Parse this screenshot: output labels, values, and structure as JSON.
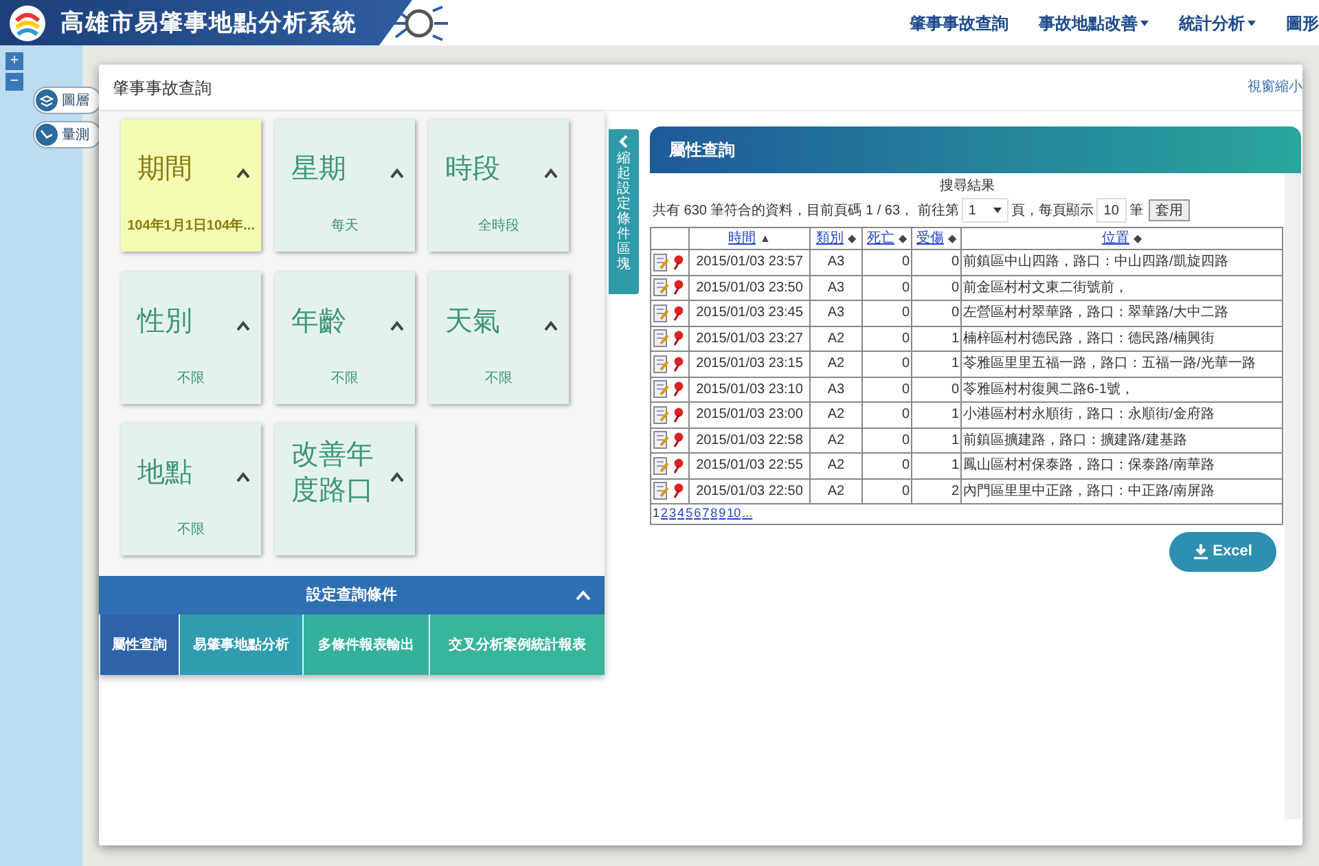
{
  "header": {
    "title": "高雄市易肇事地點分析系統",
    "nav": [
      {
        "label": "肇事事故查詢",
        "dropdown": false
      },
      {
        "label": "事故地點改善",
        "dropdown": true
      },
      {
        "label": "統計分析",
        "dropdown": true
      },
      {
        "label": "圖形",
        "dropdown": false
      }
    ]
  },
  "map_tools": {
    "zoom_in": "+",
    "zoom_out": "−",
    "buttons": [
      {
        "label": "圖層",
        "kind": "layers"
      },
      {
        "label": "量測",
        "kind": "measure"
      }
    ]
  },
  "dialog": {
    "title": "肇事事故查詢",
    "minimize": "視窗縮小",
    "filters": [
      {
        "title": "期間",
        "value": "104年1月1日104年...",
        "selected": true
      },
      {
        "title": "星期",
        "value": "每天",
        "selected": false
      },
      {
        "title": "時段",
        "value": "全時段",
        "selected": false
      },
      {
        "title": "性別",
        "value": "不限",
        "selected": false
      },
      {
        "title": "年齡",
        "value": "不限",
        "selected": false
      },
      {
        "title": "天氣",
        "value": "不限",
        "selected": false
      },
      {
        "title": "地點",
        "value": "不限",
        "selected": false
      },
      {
        "title": "改善年度路口",
        "selected": false
      }
    ],
    "settings_bar": "設定查詢條件",
    "tabs": [
      {
        "label": "屬性查詢",
        "selected": true
      },
      {
        "label": "易肇事地點分析",
        "selected": false
      },
      {
        "label": "多條件報表輸出",
        "selected": false
      },
      {
        "label": "交叉分析案例統計報表",
        "selected": false
      }
    ],
    "collapse_tab": "縮起設定條件區塊",
    "results": {
      "title": "屬性查詢",
      "caption": "搜尋結果",
      "summary_before": "共有 630 筆符合的資料，目前頁碼 1 / 63， 前往第",
      "page_select": "1",
      "summary_middle": "頁，每頁顯示",
      "page_size": "10",
      "summary_after": "筆",
      "apply": "套用",
      "columns": [
        {
          "label": "時間",
          "sort_icon": "▲"
        },
        {
          "label": "類別",
          "sort_icon": "◆"
        },
        {
          "label": "死亡",
          "sort_icon": "◆"
        },
        {
          "label": "受傷",
          "sort_icon": "◆"
        },
        {
          "label": "位置",
          "sort_icon": "◆"
        }
      ],
      "rows": [
        {
          "time": "2015/01/03 23:57",
          "type": "A3",
          "deaths": "0",
          "injuries": "0",
          "location": "前鎮區中山四路，路口：中山四路/凱旋四路"
        },
        {
          "time": "2015/01/03 23:50",
          "type": "A3",
          "deaths": "0",
          "injuries": "0",
          "location": "前金區村村文東二街號前，"
        },
        {
          "time": "2015/01/03 23:45",
          "type": "A3",
          "deaths": "0",
          "injuries": "0",
          "location": "左營區村村翠華路，路口：翠華路/大中二路"
        },
        {
          "time": "2015/01/03 23:27",
          "type": "A2",
          "deaths": "0",
          "injuries": "1",
          "location": "楠梓區村村德民路，路口：德民路/楠興街"
        },
        {
          "time": "2015/01/03 23:15",
          "type": "A2",
          "deaths": "0",
          "injuries": "1",
          "location": "苓雅區里里五福一路，路口：五福一路/光華一路"
        },
        {
          "time": "2015/01/03 23:10",
          "type": "A3",
          "deaths": "0",
          "injuries": "0",
          "location": "苓雅區村村復興二路6-1號，"
        },
        {
          "time": "2015/01/03 23:00",
          "type": "A2",
          "deaths": "0",
          "injuries": "1",
          "location": "小港區村村永順街，路口：永順街/金府路"
        },
        {
          "time": "2015/01/03 22:58",
          "type": "A2",
          "deaths": "0",
          "injuries": "1",
          "location": "前鎮區擴建路，路口：擴建路/建基路"
        },
        {
          "time": "2015/01/03 22:55",
          "type": "A2",
          "deaths": "0",
          "injuries": "1",
          "location": "鳳山區村村保泰路，路口：保泰路/南華路"
        },
        {
          "time": "2015/01/03 22:50",
          "type": "A2",
          "deaths": "0",
          "injuries": "2",
          "location": "內門區里里中正路，路口：中正路/南屏路"
        }
      ],
      "pages": [
        {
          "label": "1",
          "selected": true
        },
        {
          "label": "2",
          "selected": false
        },
        {
          "label": "3",
          "selected": false
        },
        {
          "label": "4",
          "selected": false
        },
        {
          "label": "5",
          "selected": false
        },
        {
          "label": "6",
          "selected": false
        },
        {
          "label": "7",
          "selected": false
        },
        {
          "label": "8",
          "selected": false
        },
        {
          "label": "9",
          "selected": false
        },
        {
          "label": "10",
          "selected": false
        },
        {
          "label": "...",
          "selected": false
        }
      ],
      "export": "Excel"
    }
  }
}
